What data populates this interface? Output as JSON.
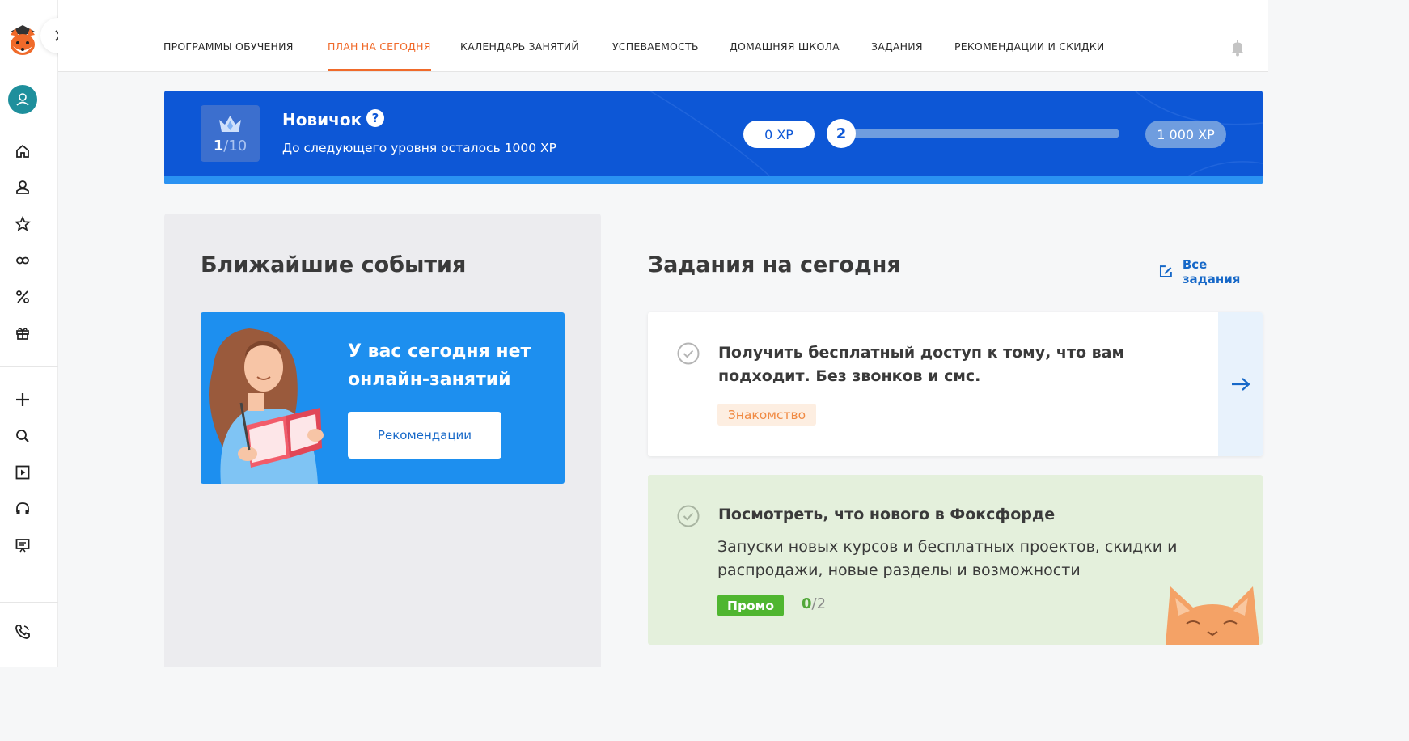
{
  "colors": {
    "accent": "#f06a2a",
    "banner": "#0d57d6",
    "link": "#1668c8",
    "promo_tag": "#4fb630",
    "intro_tag_text": "#f08a43"
  },
  "sidebar": {
    "logo_icon": "fox-logo-icon",
    "expand_icon": "chevron-right-icon",
    "avatar_icon": "user-avatar-icon",
    "items_top": [
      {
        "icon": "home-icon"
      },
      {
        "icon": "profile-icon"
      },
      {
        "icon": "star-icon"
      },
      {
        "icon": "infinity-icon"
      },
      {
        "icon": "percent-icon"
      },
      {
        "icon": "gift-icon"
      }
    ],
    "items_bottom": [
      {
        "icon": "plus-icon"
      },
      {
        "icon": "search-icon"
      },
      {
        "icon": "play-icon"
      },
      {
        "icon": "headphones-icon"
      },
      {
        "icon": "presentation-icon"
      }
    ],
    "phone_icon": "phone-icon"
  },
  "nav": {
    "items": [
      {
        "label": "ПРОГРАММЫ ОБУЧЕНИЯ",
        "active": false
      },
      {
        "label": "ПЛАН НА СЕГОДНЯ",
        "active": true
      },
      {
        "label": "КАЛЕНДАРЬ ЗАНЯТИЙ",
        "active": false
      },
      {
        "label": "УСПЕВАЕМОСТЬ",
        "active": false
      },
      {
        "label": "ДОМАШНЯЯ ШКОЛА",
        "active": false
      },
      {
        "label": "ЗАДАНИЯ",
        "active": false
      },
      {
        "label": "РЕКОМЕНДАЦИИ И СКИДКИ",
        "active": false
      }
    ],
    "bell_icon": "bell-icon"
  },
  "level": {
    "current": "1",
    "separator": "/",
    "total": "10",
    "title": "Новичок",
    "help": "?",
    "subtitle": "До следующего уровня осталось 1000 XP",
    "xp_start": "0 XP",
    "xp_end": "1 000 XP",
    "next_level": "2",
    "progress_fraction": 0.0
  },
  "events": {
    "title": "Ближайшие события",
    "empty_text": "У вас сегодня нет онлайн-занятий",
    "button": "Рекомендации"
  },
  "tasks": {
    "title": "Задания на сегодня",
    "all_link": "Все задания",
    "items": [
      {
        "title": "Получить бесплатный доступ к тому, что вам подходит. Без звонков и смс.",
        "tag": "Знакомство"
      },
      {
        "title": "Посмотреть, что нового в Фоксфорде",
        "description": "Запуски новых курсов и бесплатных проектов, скидки и распродажи, новые разделы и возможности",
        "tag": "Промо",
        "done": "0",
        "separator": "/",
        "total": "2"
      }
    ]
  }
}
